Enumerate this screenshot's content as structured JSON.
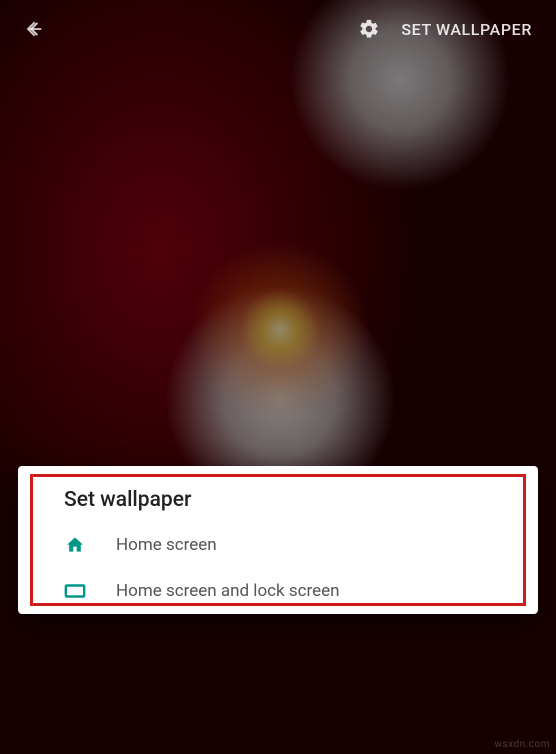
{
  "header": {
    "set_label": "SET WALLPAPER"
  },
  "dialog": {
    "title": "Set wallpaper",
    "options": [
      {
        "label": "Home screen"
      },
      {
        "label": "Home screen and lock screen"
      }
    ]
  },
  "watermark": "wsxdn.com",
  "colors": {
    "accent": "#009688",
    "annotation": "#d11a1a"
  }
}
